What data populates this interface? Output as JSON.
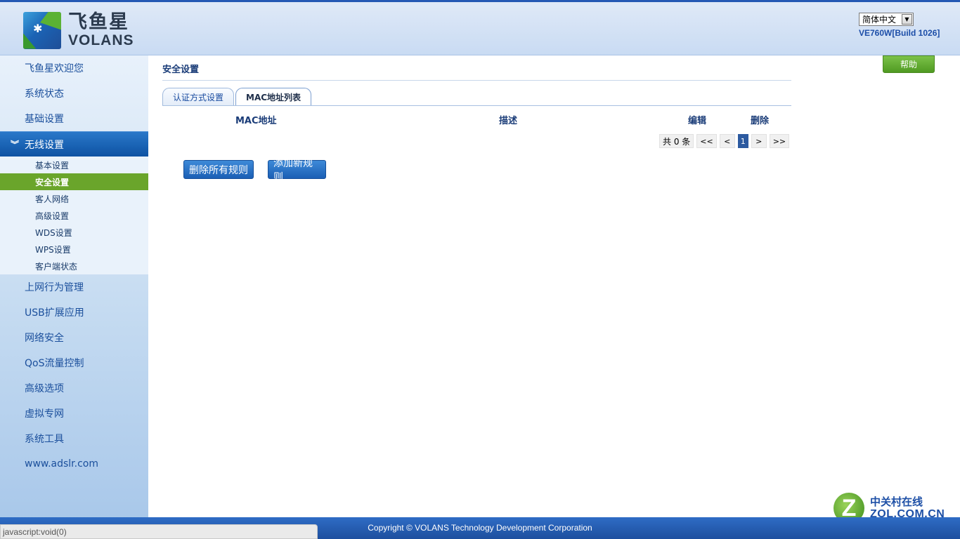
{
  "header": {
    "logo_cn": "飞鱼星",
    "logo_en": "VOLANS",
    "language": "简体中文",
    "version": "VE760W[Build 1026]"
  },
  "sidebar": {
    "items": [
      {
        "label": "飞鱼星欢迎您"
      },
      {
        "label": "系统状态"
      },
      {
        "label": "基础设置"
      },
      {
        "label": "无线设置",
        "active": true
      }
    ],
    "sub_items": [
      {
        "label": "基本设置"
      },
      {
        "label": "安全设置",
        "active": true
      },
      {
        "label": "客人网络"
      },
      {
        "label": "高级设置"
      },
      {
        "label": "WDS设置"
      },
      {
        "label": "WPS设置"
      },
      {
        "label": "客户端状态"
      }
    ],
    "items_after": [
      {
        "label": "上网行为管理"
      },
      {
        "label": "USB扩展应用"
      },
      {
        "label": "网络安全"
      },
      {
        "label": "QoS流量控制"
      },
      {
        "label": "高级选项"
      },
      {
        "label": "虚拟专网"
      },
      {
        "label": "系统工具"
      },
      {
        "label": "www.adslr.com"
      }
    ]
  },
  "main": {
    "title": "安全设置",
    "help": "帮助",
    "tabs": [
      {
        "label": "认证方式设置"
      },
      {
        "label": "MAC地址列表",
        "active": true
      }
    ],
    "table": {
      "columns": [
        "MAC地址",
        "描述",
        "编辑",
        "删除"
      ],
      "rows": []
    },
    "pager": {
      "total": "共 0 条",
      "first": "<<",
      "prev": "<",
      "current": "1",
      "next": ">",
      "last": ">>"
    },
    "buttons": {
      "delete_all": "删除所有规则",
      "add_new": "添加新规则"
    }
  },
  "footer": {
    "copyright": "Copyright © VOLANS Technology Development Corporation",
    "status": "javascript:void(0)"
  },
  "watermark": {
    "letter": "Z",
    "cn": "中关村在线",
    "en": "ZOL.COM.CN"
  }
}
